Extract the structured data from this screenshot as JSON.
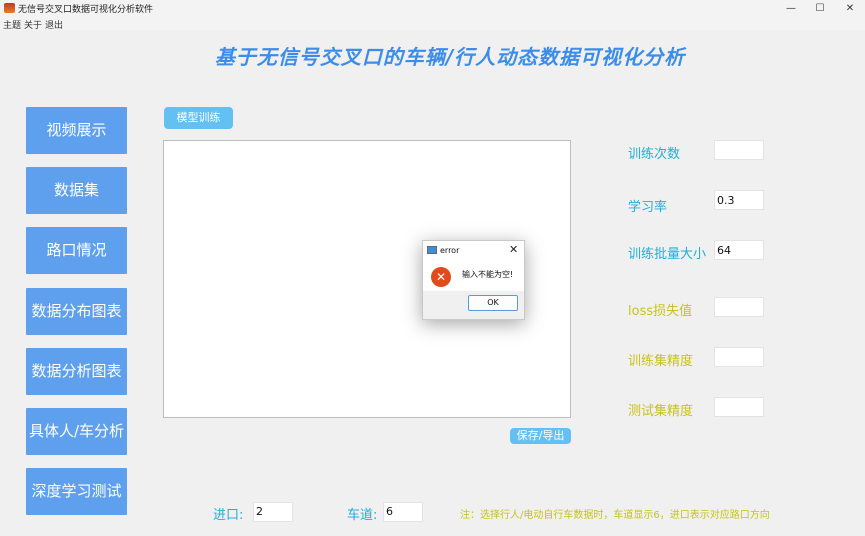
{
  "window": {
    "title": "无信号交叉口数据可视化分析软件",
    "minimize": "—",
    "maximize": "☐",
    "close": "✕"
  },
  "menu": [
    "主题",
    "关于",
    "退出"
  ],
  "heading": "基于无信号交叉口的车辆/行人动态数据可视化分析",
  "nav": [
    "视频展示",
    "数据集",
    "路口情况",
    "数据分布图表",
    "数据分析图表",
    "具体人/车分析",
    "深度学习测试"
  ],
  "train_button": "模型训练",
  "save_button": "保存/导出",
  "fields": {
    "epochs": {
      "label": "训练次数",
      "value": ""
    },
    "lr": {
      "label": "学习率",
      "value": "0.3"
    },
    "batch": {
      "label": "训练批量大小",
      "value": "64"
    },
    "loss": {
      "label": "loss损失值",
      "value": ""
    },
    "train_acc": {
      "label": "训练集精度",
      "value": ""
    },
    "test_acc": {
      "label": "测试集精度",
      "value": ""
    }
  },
  "bottom": {
    "entry_label": "进口:",
    "entry_value": "2",
    "lane_label": "车道:",
    "lane_value": "6",
    "note": "注：选择行人/电动自行车数据时，车道显示6，进口表示对应路口方向"
  },
  "dialog": {
    "title": "error",
    "close": "✕",
    "icon": "✕",
    "message": "输入不能为空!",
    "ok": "OK"
  }
}
